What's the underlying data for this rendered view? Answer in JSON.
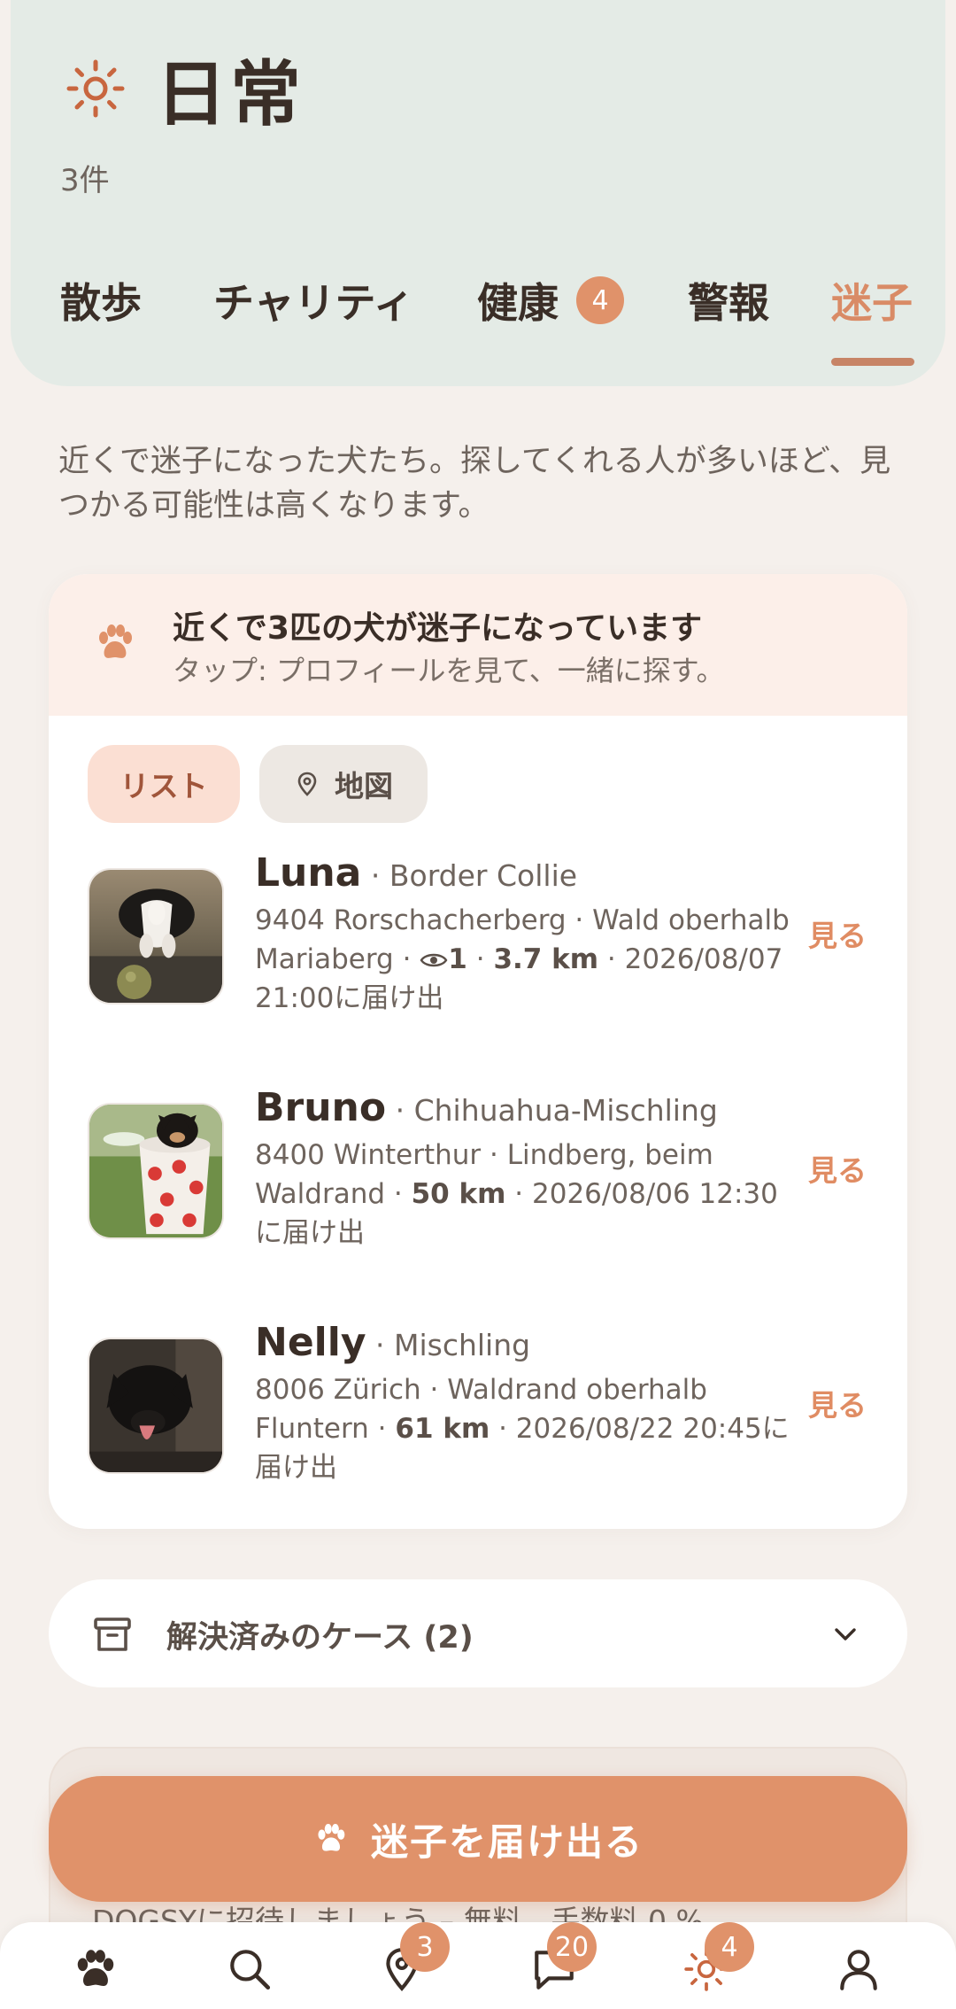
{
  "header": {
    "title": "日常",
    "count": "3件",
    "tabs": [
      {
        "label": "散歩"
      },
      {
        "label": "チャリティ"
      },
      {
        "label": "健康",
        "badge": "4"
      },
      {
        "label": "警報"
      },
      {
        "label": "迷子",
        "active": true
      }
    ]
  },
  "intro": "近くで迷子になった犬たち。探してくれる人が多いほど、見つかる可能性は高くなります。",
  "banner": {
    "title": "近くで3匹の犬が迷子になっています",
    "subtitle": "タップ: プロフィールを見て、一緒に探す。"
  },
  "view_toggle": {
    "list_label": "リスト",
    "map_label": "地図"
  },
  "dogs": [
    {
      "name": "Luna",
      "breed": "· Border Collie",
      "location": "9404 Rorschacherberg · Wald oberhalb Mariaberg · ",
      "views": "1",
      "sep1": " · ",
      "distance": "3.7 km",
      "reported": " · 2026/08/07 21:00に届け出",
      "action": "見る"
    },
    {
      "name": "Bruno",
      "breed": "· Chihuahua-Mischling",
      "location": "8400 Winterthur · Lindberg, beim Waldrand · ",
      "distance": "50 km",
      "reported": " · 2026/08/06 12:30に届け出",
      "action": "見る"
    },
    {
      "name": "Nelly",
      "breed": "· Mischling",
      "location": "8006 Zürich · Waldrand oberhalb Fluntern · ",
      "distance": "61 km",
      "reported": " · 2026/08/22 20:45に届け出",
      "action": "見る"
    }
  ],
  "resolved": {
    "label": "解決済みのケース (2)"
  },
  "invite": {
    "text": "DOGSYに招待しましょう – 無料、手数料 0 %。"
  },
  "report_button": {
    "label": "迷子を届け出る"
  },
  "bottom_nav": [
    {
      "icon": "paw-icon"
    },
    {
      "icon": "search-icon"
    },
    {
      "icon": "map-pin-icon",
      "badge": "3"
    },
    {
      "icon": "chat-icon",
      "badge": "20"
    },
    {
      "icon": "sun-icon",
      "badge": "4"
    },
    {
      "icon": "profile-icon"
    }
  ],
  "colors": {
    "accent": "#e0926a",
    "header_bg": "#e4ebe6",
    "page_bg": "#f5f0ec",
    "banner_bg": "#fcefe9"
  }
}
